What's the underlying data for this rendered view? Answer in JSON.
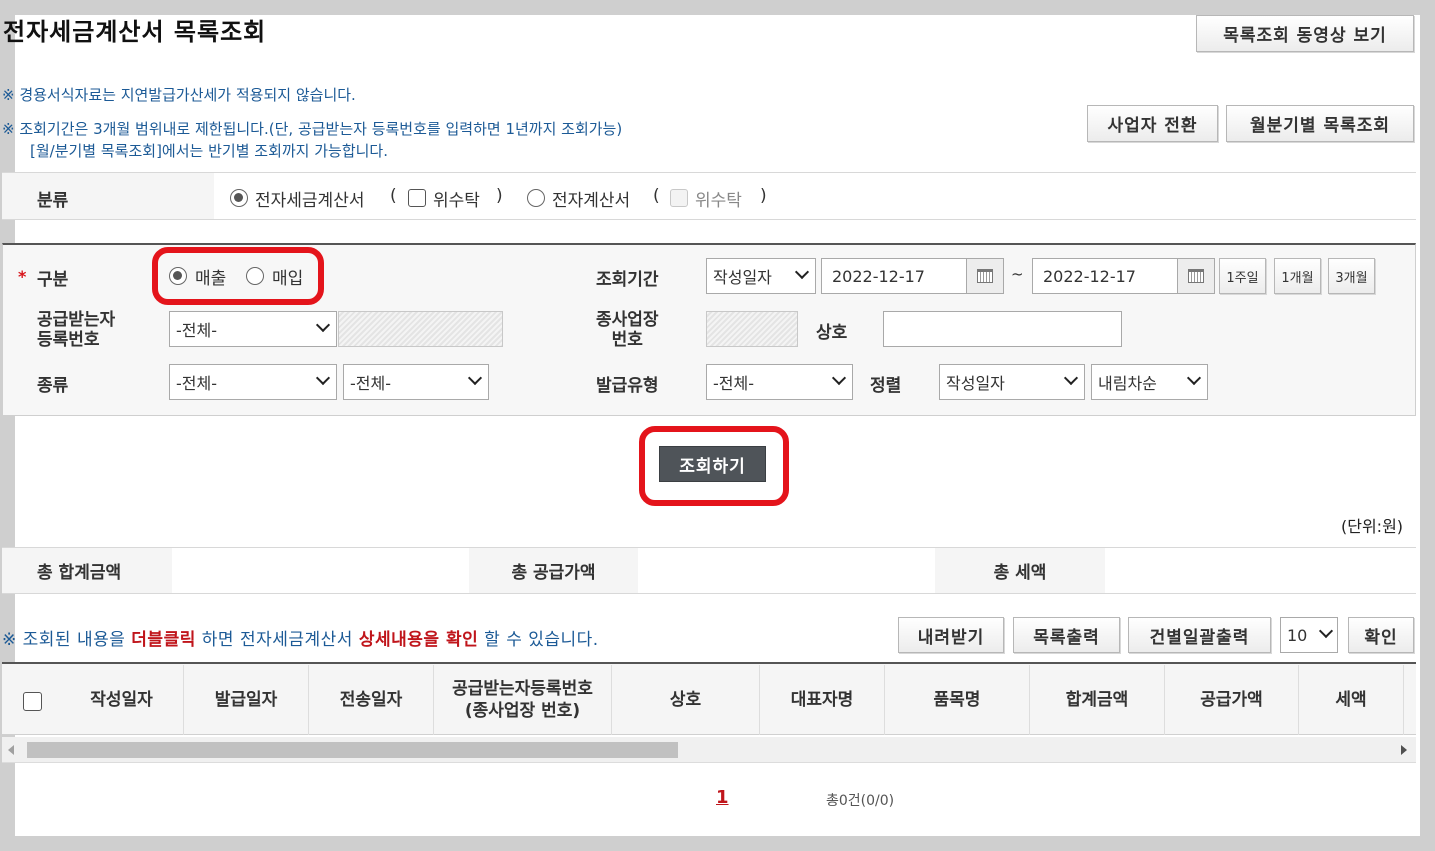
{
  "page": {
    "title": "전자세금계산서 목록조회",
    "video_button": "목록조회 동영상 보기",
    "switch_business_button": "사업자 전환",
    "monthly_button": "월분기별 목록조회"
  },
  "notices": {
    "line1": "※ 경용서식자료는 지연발급가산세가 적용되지 않습니다.",
    "line2": "※ 조회기간은 3개월 범위내로 제한됩니다.(단, 공급받는자 등록번호를 입력하면 1년까지 조회가능)",
    "line3": "[월/분기별 목록조회]에서는 반기별 조회까지 가능합니다."
  },
  "category": {
    "label": "분류",
    "option1": "전자세금계산서",
    "open_paren": "(",
    "close_paren": ")",
    "consign1": "위수탁",
    "option2": "전자계산서",
    "consign2": "위수탁",
    "selected": "전자세금계산서"
  },
  "search": {
    "required_mark": "*",
    "type_label": "구분",
    "type_sales": "매출",
    "type_purchase": "매입",
    "type_selected": "매출",
    "period_label": "조회기간",
    "period_basis": "작성일자",
    "date_from": "2022-12-17",
    "tilde": "~",
    "date_to": "2022-12-17",
    "quick_1week": "1주일",
    "quick_1month": "1개월",
    "quick_3month": "3개월",
    "receiver_label_1": "공급받는자",
    "receiver_label_2": "등록번호",
    "receiver_select": "-전체-",
    "branch_label_1": "종사업장",
    "branch_label_2": "번호",
    "company_label": "상호",
    "company_value": "",
    "kind_label": "종류",
    "kind_select_1": "-전체-",
    "kind_select_2": "-전체-",
    "issue_type_label": "발급유형",
    "issue_type_select": "-전체-",
    "sort_label": "정렬",
    "sort_field": "작성일자",
    "sort_order": "내림차순",
    "submit": "조회하기"
  },
  "summary": {
    "unit": "(단위:원)",
    "total_amount_label": "총 합계금액",
    "total_amount": "",
    "supply_label": "총 공급가액",
    "supply": "",
    "tax_label": "총 세액",
    "tax": ""
  },
  "hint": {
    "prefix": "※ 조회된 내용을 ",
    "emph1": "더블클릭",
    "middle": " 하면 전자세금계산서 ",
    "emph2": "상세내용을 확인",
    "suffix": " 할 수 있습니다."
  },
  "list_actions": {
    "download": "내려받기",
    "print_list": "목록출력",
    "batch_print": "건별일괄출력",
    "page_size": "10",
    "confirm": "확인"
  },
  "table": {
    "headers": [
      "작성일자",
      "발급일자",
      "전송일자",
      "공급받는자등록번호",
      "(종사업장 번호)",
      "상호",
      "대표자명",
      "품목명",
      "합계금액",
      "공급가액",
      "세액"
    ]
  },
  "pagination": {
    "current_page": "1",
    "total": "총0건(0/0)"
  },
  "colors": {
    "highlight": "#e4141b",
    "notice": "#1c5a96",
    "emphasis": "#c0151b",
    "submit_bg": "#4f5459"
  }
}
